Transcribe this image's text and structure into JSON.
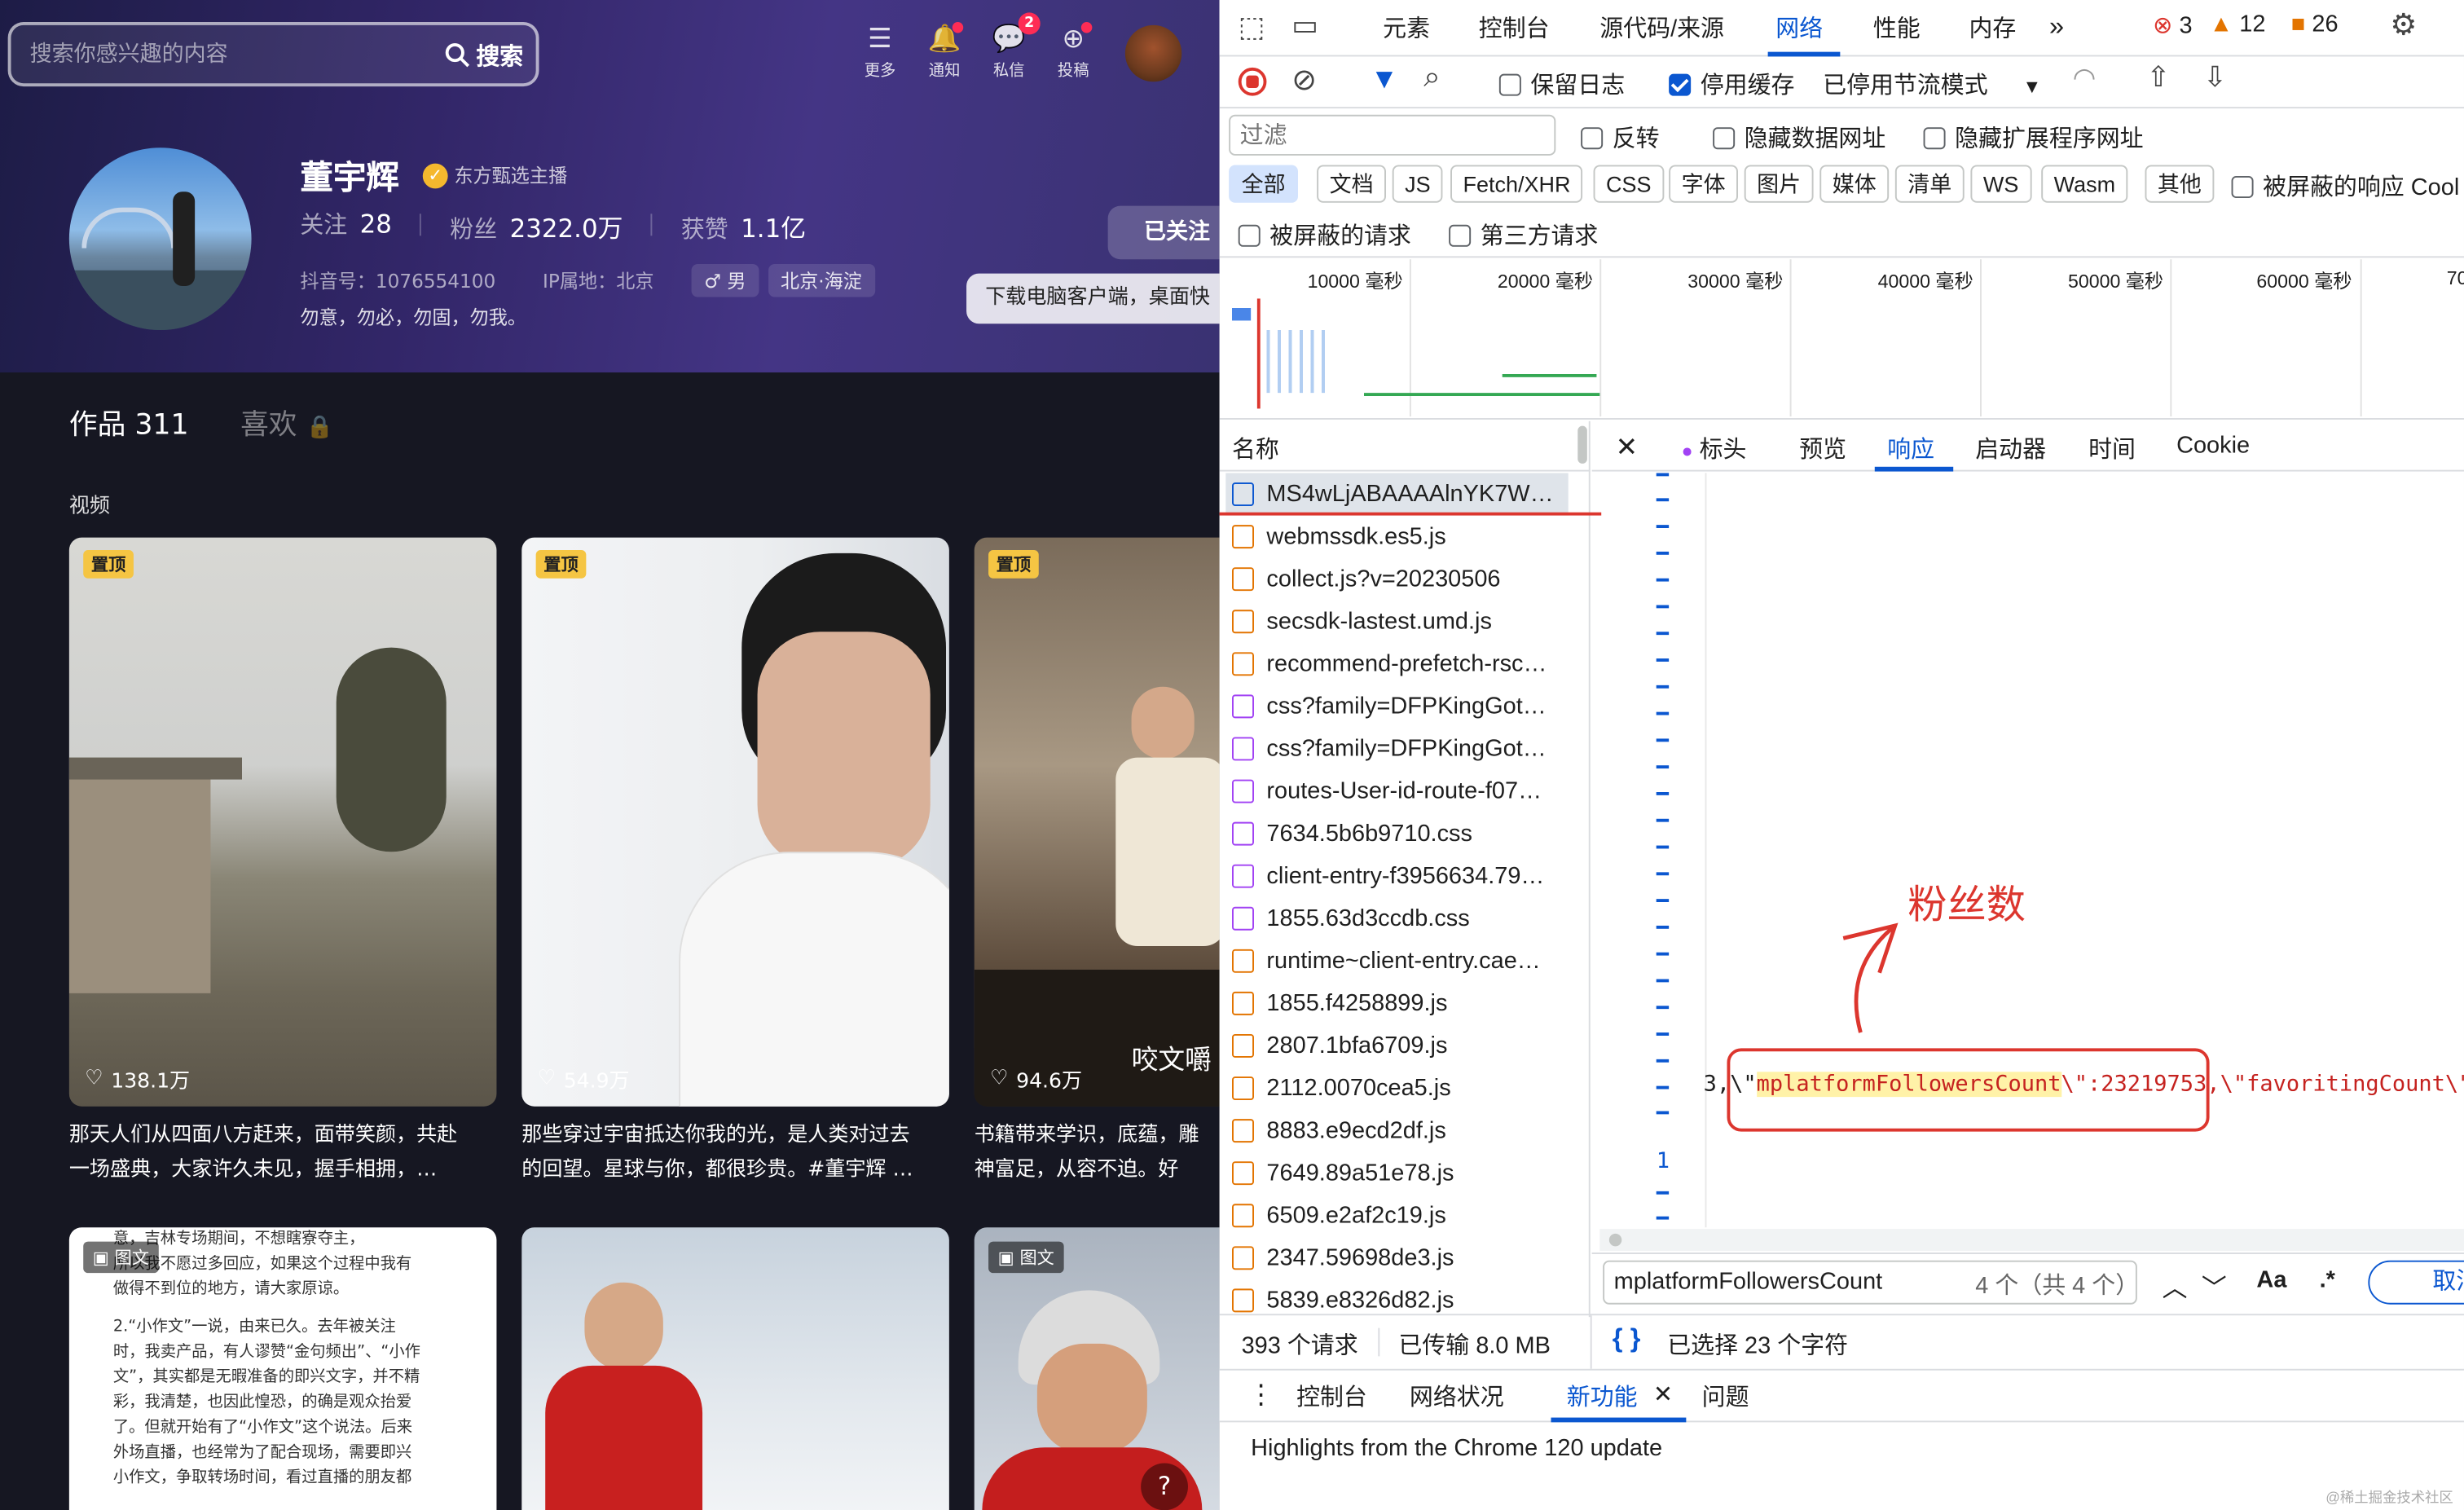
{
  "left_app": {
    "search": {
      "placeholder": "搜索你感兴趣的内容",
      "button": "搜索"
    },
    "top_nav": [
      {
        "label": "更多",
        "icon": "menu-icon"
      },
      {
        "label": "通知",
        "icon": "bell-icon"
      },
      {
        "label": "私信",
        "icon": "message-icon",
        "badge": "2"
      },
      {
        "label": "投稿",
        "icon": "upload-icon"
      }
    ],
    "profile": {
      "name": "董宇辉",
      "verified_label": "东方甄选主播",
      "stats": [
        {
          "label": "关注",
          "value": "28"
        },
        {
          "label": "粉丝",
          "value": "2322.0万"
        },
        {
          "label": "获赞",
          "value": "1.1亿"
        }
      ],
      "douyin_id": "抖音号：1076554100",
      "ip": "IP属地：北京",
      "gender": "♂ 男",
      "location": "北京·海淀",
      "bio": "勿意，勿必，勿固，勿我。",
      "followed_button": "已关注",
      "download_tip": "下载电脑客户端，桌面快"
    },
    "tabs": {
      "works": "作品 311",
      "likes": "喜欢"
    },
    "section_title": "视频",
    "videos": [
      {
        "pin": "置顶",
        "likes": "138.1万",
        "caption1": "那天人们从四面八方赶来，面带笑颜，共赴",
        "caption2": "一场盛典，大家许久未见，握手相拥，…"
      },
      {
        "pin": "置顶",
        "likes": "54.9万",
        "caption1": "那些穿过宇宙抵达你我的光，是人类对过去",
        "caption2": "的回望。星球与你，都很珍贵。#董宇辉 …"
      },
      {
        "pin": "置顶",
        "likes": "94.6万",
        "overlay": "咬文嚼",
        "caption1": "书籍带来学识，底蕴，雕",
        "caption2": "神富足，从容不迫。好"
      }
    ],
    "second_row": [
      {
        "tag": "图文",
        "text1": "意，吉林专场期间，不想瞎寮夺主，",
        "text2": "所以我不愿过多回应，如果这个过程中我有",
        "text3": "做得不到位的地方，请大家原谅。",
        "text4": "2.“小作文”一说，由来已久。去年被关注",
        "text5": "时，我卖产品，有人谬赞“金句频出”、“小作",
        "text6": "文”，其实都是无暇准备的即兴文字，并不精",
        "text7": "彩，我清楚，也因此惶恐，的确是观众抬爱",
        "text8": "了。但就开始有了“小作文”这个说法。后来",
        "text9": "外场直播，也经常为了配合现场，需要即兴",
        "text10": "小作文，争取转场时间，看过直播的朋友都"
      },
      {
        "tag": ""
      },
      {
        "tag": "图文"
      }
    ]
  },
  "devtools": {
    "tabs": [
      "元素",
      "控制台",
      "源代码/来源",
      "网络",
      "性能",
      "内存"
    ],
    "active_tab": "网络",
    "counts": {
      "errors": "3",
      "warnings": "12",
      "issues": "26"
    },
    "toolbar": {
      "preserve_log": "保留日志",
      "disable_cache": "停用缓存",
      "throttle": "已停用节流模式"
    },
    "filter": {
      "placeholder": "过滤",
      "invert": "反转",
      "hide_data_urls": "隐藏数据网址",
      "hide_ext_urls": "隐藏扩展程序网址"
    },
    "types": [
      "全部",
      "文档",
      "JS",
      "Fetch/XHR",
      "CSS",
      "字体",
      "图片",
      "媒体",
      "清单",
      "WS",
      "Wasm",
      "其他"
    ],
    "blocked_response": "被屏蔽的响应 Cool",
    "blocked_requests": "被屏蔽的请求",
    "third_party": "第三方请求",
    "timeline_ticks": [
      "10000 毫秒",
      "20000 毫秒",
      "30000 毫秒",
      "40000 毫秒",
      "50000 毫秒",
      "60000 毫秒",
      "70"
    ],
    "name_header": "名称",
    "requests": [
      {
        "name": "MS4wLjABAAAAlnYK7W…",
        "type": "doc"
      },
      {
        "name": "webmssdk.es5.js",
        "type": "js"
      },
      {
        "name": "collect.js?v=20230506",
        "type": "js"
      },
      {
        "name": "secsdk-lastest.umd.js",
        "type": "js"
      },
      {
        "name": "recommend-prefetch-rsc…",
        "type": "js"
      },
      {
        "name": "css?family=DFPKingGot…",
        "type": "css"
      },
      {
        "name": "css?family=DFPKingGot…",
        "type": "css"
      },
      {
        "name": "routes-User-id-route-f07…",
        "type": "css"
      },
      {
        "name": "7634.5b6b9710.css",
        "type": "css"
      },
      {
        "name": "client-entry-f3956634.79…",
        "type": "css"
      },
      {
        "name": "1855.63d3ccdb.css",
        "type": "css"
      },
      {
        "name": "runtime~client-entry.cae…",
        "type": "js"
      },
      {
        "name": "1855.f4258899.js",
        "type": "js"
      },
      {
        "name": "2807.1bfa6709.js",
        "type": "js"
      },
      {
        "name": "2112.0070cea5.js",
        "type": "js"
      },
      {
        "name": "8883.e9ecd2df.js",
        "type": "js"
      },
      {
        "name": "7649.89a51e78.js",
        "type": "js"
      },
      {
        "name": "6509.e2af2c19.js",
        "type": "js"
      },
      {
        "name": "2347.59698de3.js",
        "type": "js"
      },
      {
        "name": "5839.e8326d82.js",
        "type": "js"
      }
    ],
    "detail_tabs": [
      "标头",
      "预览",
      "响应",
      "启动器",
      "时间",
      "Cookie"
    ],
    "active_detail_tab": "响应",
    "response": {
      "code_prefix": "3,\\\"",
      "highlight": "mplatformFollowersCount",
      "code_mid": "\\\":23219753",
      "code_suffix": ",\\\"favoritingCount\\\"",
      "line_number": "1",
      "annotation": "粉丝数"
    },
    "search_bar": {
      "value": "mplatformFollowersCount",
      "result": "4 个（共 4 个）",
      "case_label": "Aa",
      "regex_label": ".*",
      "cancel": "取消"
    },
    "status": {
      "requests": "393 个请求",
      "transferred": "已传输 8.0 MB",
      "selection": "已选择 23 个字符"
    },
    "drawer_tabs": [
      "控制台",
      "网络状况",
      "新功能",
      "问题"
    ],
    "drawer_active": "新功能",
    "drawer_content": "Highlights from the Chrome 120 update",
    "watermark": "@稀土掘金技术社区"
  }
}
